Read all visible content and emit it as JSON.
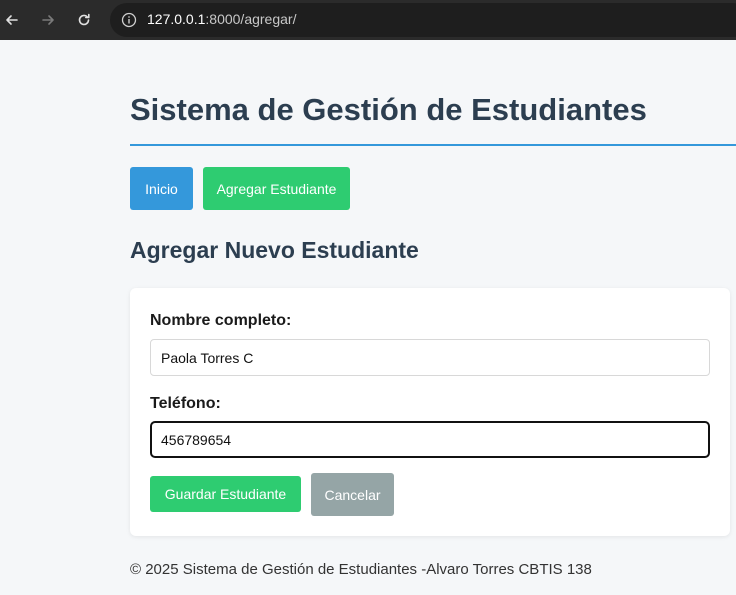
{
  "browser": {
    "url_host": "127.0.0.1",
    "url_rest": ":8000/agregar/"
  },
  "header": {
    "title": "Sistema de Gestión de Estudiantes"
  },
  "nav": {
    "home_label": "Inicio",
    "add_label": "Agregar Estudiante"
  },
  "form": {
    "section_title": "Agregar Nuevo Estudiante",
    "name_label": "Nombre completo:",
    "name_value": "Paola Torres C",
    "phone_label": "Teléfono:",
    "phone_value": "456789654",
    "save_label": "Guardar Estudiante",
    "cancel_label": "Cancelar"
  },
  "footer": {
    "text": "© 2025 Sistema de Gestión de Estudiantes -Alvaro Torres CBTIS 138"
  },
  "colors": {
    "primary": "#3498db",
    "success": "#2ecc71",
    "secondary": "#95a5a6",
    "heading": "#2c3e50"
  },
  "icons": [
    "back-arrow-icon",
    "forward-arrow-icon",
    "reload-icon",
    "info-icon"
  ]
}
